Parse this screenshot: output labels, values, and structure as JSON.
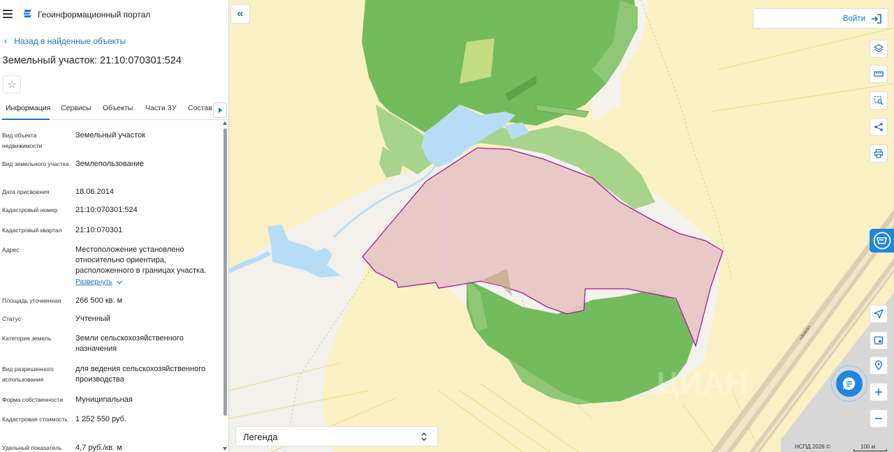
{
  "header": {
    "app_title": "Геоинформационный портал"
  },
  "navigation": {
    "back_label": "Назад в найденные объекты"
  },
  "parcel": {
    "title": "Земельный участок: 21:10:070301:524"
  },
  "tabs": [
    {
      "label": "Информация",
      "active": true
    },
    {
      "label": "Сервисы"
    },
    {
      "label": "Объекты"
    },
    {
      "label": "Части ЗУ"
    },
    {
      "label": "Состав"
    }
  ],
  "properties": [
    {
      "label": "Вид объекта недвижимости",
      "value": "Земельный участок"
    },
    {
      "label": "Вид земельного участка",
      "value": "Землепользование"
    },
    {
      "label": "Дата присвоения",
      "value": "18.06.2014"
    },
    {
      "label": "Кадастровый номер",
      "value": "21:10:070301:524"
    },
    {
      "label": "Кадастровый квартал",
      "value": "21:10:070301"
    },
    {
      "label": "Адрес",
      "value": "Местоположение установлено относительно ориентира, расположенного в границах участка.",
      "link": "Развернуть"
    },
    {
      "label": "Площадь уточненная",
      "value": "266 500 кв. м"
    },
    {
      "label": "Статус",
      "value": "Учтенный"
    },
    {
      "label": "Категория земель",
      "value": "Земли сельскохозяйственного назначения"
    },
    {
      "label": "Вид разрешенного использования",
      "value": "для ведения сельскохозяйственного производства"
    },
    {
      "label": "Форма собственности",
      "value": "Муниципальная"
    },
    {
      "label": "Кадастровая стоимость",
      "value": "1 252 550 руб."
    },
    {
      "label": "Удельный показатель",
      "value": "4,7 руб./кв. м"
    }
  ],
  "map": {
    "login_label": "Войти",
    "legend_label": "Легенда",
    "copyright": "НСПД 2026 ©",
    "scale_label": "100 м",
    "road_label": "«Анна»",
    "watermark": "ЦИАН",
    "colors": {
      "background": "#f9f1c3",
      "forest": "#73bb5c",
      "forest_light": "#a8d38a",
      "water": "#b6dcf6",
      "parcel_fill": "#e7c6c3",
      "parcel_stroke": "#a1199e",
      "accent": "#1e86e0"
    }
  }
}
